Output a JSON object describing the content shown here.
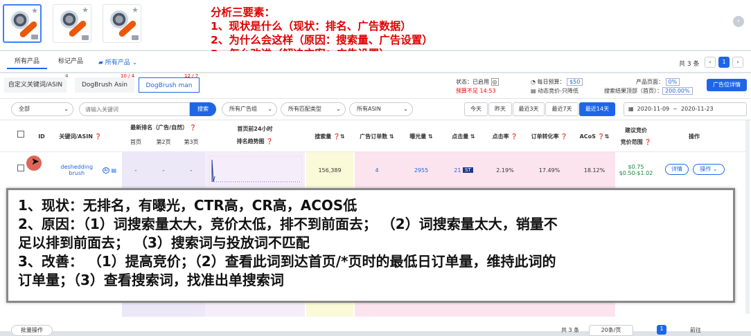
{
  "annotation_top": {
    "title": "分析三要素：",
    "line1": "1、现状是什么（现状：排名、广告数据）",
    "line2": "2、为什么会这样（原因：搜索量、广告设置）",
    "line3": "3、怎么改进（解决方案：广告设置）"
  },
  "filter_tabs": {
    "all": "所有产品",
    "marked": "标记产品",
    "all2": "所有产品"
  },
  "pager": {
    "total": "共 3 条",
    "page": "1"
  },
  "campaign_tabs": [
    {
      "label": "自定义关键词/ASIN",
      "count": "4"
    },
    {
      "label": "DogBrush Asin",
      "count": "10 / 4"
    },
    {
      "label": "DogBrush man",
      "count": "12 / 7"
    }
  ],
  "status": {
    "state_label": "状态：",
    "state": "已启用",
    "budget_label": "预算不足",
    "budget_time": "14:53",
    "daily_label": "每日预算：",
    "daily": "$50",
    "strategy": "动态竞价-只降低",
    "product_page_label": "产品页面：",
    "product_page": "0%",
    "search_top_label": "搜索结果顶部（首页）：",
    "search_top": "200.00%",
    "placement_btn": "广告位详情"
  },
  "toolbar": {
    "all": "全部",
    "kw_placeholder": "请输入关键词",
    "search": "搜索",
    "groups": "所有广告组",
    "match": "所有匹配类型",
    "asin": "所有ASIN",
    "today": "今天",
    "yesterday": "昨天",
    "last3": "最近3天",
    "last7": "最近7天",
    "last14": "最近14天",
    "date_from": "2020-11-09",
    "date_sep": "~",
    "date_to": "2020-11-23"
  },
  "table": {
    "id": "ID",
    "kw": "关键词/ASIN",
    "rank": "最新排名（广告/自然）",
    "p1": "首页",
    "p2": "第2页",
    "p3": "第3页",
    "trend1": "首页前24小时",
    "trend2": "排名趋势图",
    "search_vol": "搜索量",
    "orders": "广告订单数",
    "impr": "曝光量",
    "clicks": "点击量",
    "ctr": "点击率",
    "cr": "订单转化率",
    "acos": "ACoS",
    "bid1": "建议竞价",
    "bid2": "竞价范围",
    "ops": "操作"
  },
  "row": {
    "kw": "deshedding brush",
    "p1": "-",
    "p2": "-",
    "p3": "-",
    "search_vol": "156,389",
    "orders": "4",
    "impr": "2955",
    "clicks": "21",
    "tag": "ST",
    "ctr": "2.19%",
    "cr": "17.49%",
    "acos": "18.12%",
    "bid": "$0.75",
    "bid_range": "$0.50-$1.02",
    "detail": "详情",
    "action": "操作"
  },
  "annotation_bottom": {
    "l1": "1、现状：无排名，有曝光，CTR高，CR高，ACOS低",
    "l2": "2、原因：（1）词搜索量太大，竞价太低，排不到前面去；  （2）词搜索量太大，销量不",
    "l3": "足以排到前面去；  （3）搜索词与投放词不匹配",
    "l4": "3、改善：  （1）提高竞价；（2）查看此词到达首页/*页时的最低日订单量，维持此词的",
    "l5": "订单量；（3）查看搜索词，找准出单搜索词"
  },
  "footer": {
    "batch": "批量操作",
    "total": "共 3 条",
    "per": "20条/页",
    "goto": "前往",
    "page": "1"
  }
}
